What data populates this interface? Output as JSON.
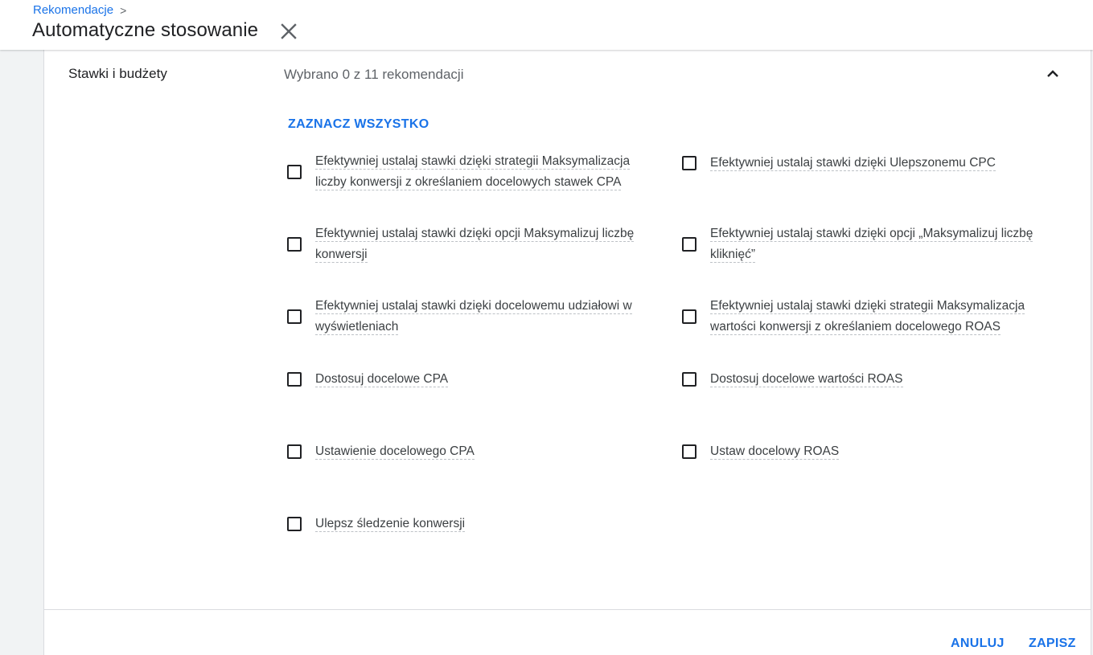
{
  "breadcrumb": {
    "parent": "Rekomendacje",
    "separator": ">"
  },
  "header": {
    "title": "Automatyczne stosowanie",
    "close_icon": "close-icon"
  },
  "section": {
    "title": "Stawki i budżety",
    "selected_count": "Wybrano 0 z 11 rekomendacji",
    "collapse_icon": "chevron-up-icon",
    "select_all": "ZAZNACZ WSZYSTKO"
  },
  "options": [
    {
      "label": "Efektywniej ustalaj stawki dzięki strategii Maksymalizacja liczby konwersji z określaniem docelowych stawek CPA",
      "checked": false
    },
    {
      "label": "Efektywniej ustalaj stawki dzięki Ulepszonemu CPC",
      "checked": false
    },
    {
      "label": "Efektywniej ustalaj stawki dzięki opcji Maksymalizuj liczbę konwersji",
      "checked": false
    },
    {
      "label": "Efektywniej ustalaj stawki dzięki opcji „Maksymalizuj liczbę kliknięć”",
      "checked": false
    },
    {
      "label": "Efektywniej ustalaj stawki dzięki docelowemu udziałowi w wyświetleniach",
      "checked": false
    },
    {
      "label": "Efektywniej ustalaj stawki dzięki strategii Maksymalizacja wartości konwersji z określaniem docelowego ROAS",
      "checked": false
    },
    {
      "label": "Dostosuj docelowe CPA",
      "checked": false
    },
    {
      "label": "Dostosuj docelowe wartości ROAS",
      "checked": false
    },
    {
      "label": "Ustawienie docelowego CPA",
      "checked": false
    },
    {
      "label": "Ustaw docelowy ROAS",
      "checked": false
    },
    {
      "label": "Ulepsz śledzenie konwersji",
      "checked": false
    }
  ],
  "footer": {
    "cancel": "ANULUJ",
    "save": "ZAPISZ"
  },
  "colors": {
    "accent": "#1a73e8",
    "text_primary": "#202124",
    "text_secondary": "#5f6368"
  }
}
